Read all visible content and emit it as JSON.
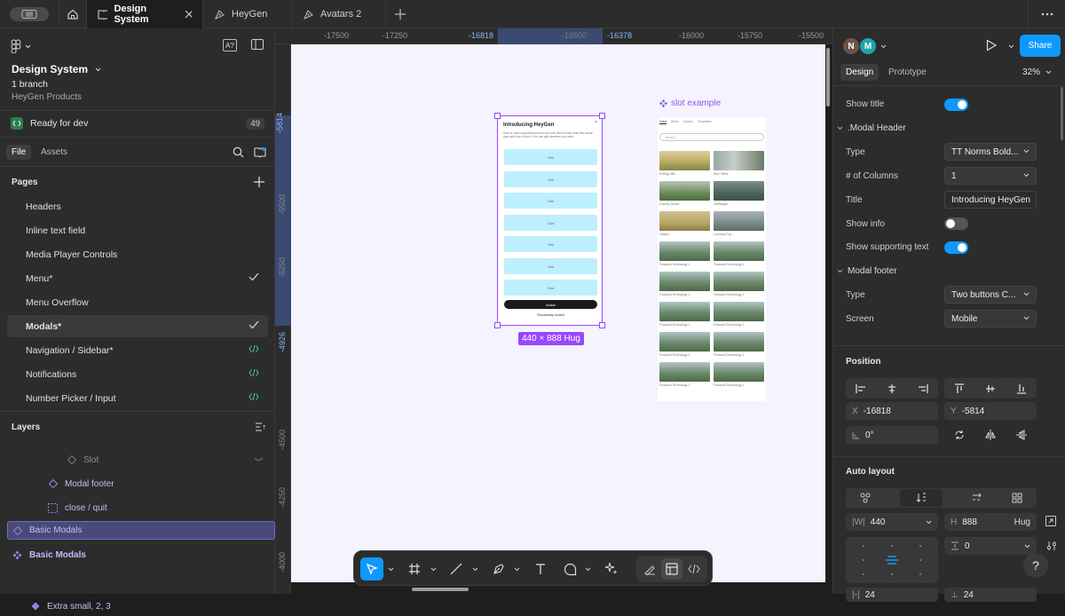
{
  "tabs": [
    {
      "label": "Design System"
    },
    {
      "label": "HeyGen"
    },
    {
      "label": "Avatars 2"
    }
  ],
  "file": {
    "name": "Design System",
    "branch": "1 branch",
    "team": "HeyGen Products",
    "ready_label": "Ready for dev",
    "ready_count": "49"
  },
  "left_tabs": {
    "file": "File",
    "assets": "Assets"
  },
  "pages": {
    "title": "Pages",
    "items": [
      {
        "label": "Headers",
        "trail": ""
      },
      {
        "label": "Inline text field",
        "trail": ""
      },
      {
        "label": "Media Player Controls",
        "trail": ""
      },
      {
        "label": "Menu*",
        "trail": "check"
      },
      {
        "label": "Menu Overflow",
        "trail": ""
      },
      {
        "label": "Modals*",
        "trail": "check"
      },
      {
        "label": "Navigation / Sidebar*",
        "trail": "code"
      },
      {
        "label": "Notifications",
        "trail": "code"
      },
      {
        "label": "Number Picker / Input",
        "trail": "code"
      }
    ]
  },
  "layers": {
    "title": "Layers",
    "items": [
      {
        "label": "Slot"
      },
      {
        "label": "Modal footer"
      },
      {
        "label": "close / quit"
      },
      {
        "label": "Basic Modals"
      },
      {
        "label": "Basic Modals"
      },
      {
        "label": "Extra small, 2, 3"
      }
    ]
  },
  "rulers": {
    "x": [
      "-17500",
      "-17250",
      "-16818",
      "-16500",
      "-16378",
      "-16000",
      "-15750",
      "-15500"
    ],
    "y": [
      "-5814",
      "-5500",
      "-5250",
      "-4926",
      "-4500",
      "-4250",
      "-4000"
    ]
  },
  "frame": {
    "size_label": "440 × 888 Hug",
    "modal_title": "Introducing HeyGen",
    "modal_body": "Here is some supporting text that you can add to share what this modal does and how to use it. You can add whatever you need.",
    "slot_label": "Slot",
    "action_label": "Action",
    "secondary_label": "Secondary Action"
  },
  "slot_example": {
    "title": "slot example",
    "tabs": [
      "Color",
      "Black",
      "Options",
      "Templates"
    ],
    "search": "Search",
    "captions": [
      [
        "Rolling Hills",
        "Nice Office"
      ],
      [
        "Country Scene",
        "Cliffhanger"
      ],
      [
        "Valleys",
        "Looming Fog"
      ],
      [
        "Financial Technology 1",
        "Financial Technology 1"
      ],
      [
        "Financial Technology 1",
        "Financial Technology 1"
      ],
      [
        "Financial Technology 1",
        "Financial Technology 1"
      ],
      [
        "Financial Technology 1",
        "Financial Technology 1"
      ],
      [
        "Financial Technology 1",
        "Financial Technology 1"
      ]
    ]
  },
  "right": {
    "avatars": [
      "N",
      "M"
    ],
    "share": "Share",
    "tabs": {
      "design": "Design",
      "prototype": "Prototype"
    },
    "zoom": "32%",
    "show_title": "Show title",
    "modal_header": ".Modal Header",
    "type_label": "Type",
    "type_value": "TT Norms Bold...",
    "columns_label": "# of Columns",
    "columns_value": "1",
    "title_label": "Title",
    "title_value": "Introducing HeyGen",
    "show_info": "Show info",
    "show_supporting": "Show supporting text",
    "modal_footer": "Modal footer",
    "footer_type_label": "Type",
    "footer_type_value": "Two buttons C...",
    "screen_label": "Screen",
    "screen_value": "Mobile",
    "position": "Position",
    "x_pre": "X",
    "x_value": "-16818",
    "y_pre": "Y",
    "y_value": "-5814",
    "rotation": "0°",
    "auto_layout": "Auto layout",
    "w_pre": "|W|",
    "w_value": "440",
    "h_pre": "H",
    "h_value": "888",
    "h_mode": "Hug",
    "gap_value": "0",
    "bottom_a": "24",
    "bottom_b": "24"
  },
  "toggles": {
    "show_title": true,
    "show_info": false,
    "show_supporting": true
  },
  "colors": {
    "accent": "#0d99ff",
    "selection": "#9747ff",
    "code": "#4ec98a",
    "component": "#9a7fe0"
  }
}
